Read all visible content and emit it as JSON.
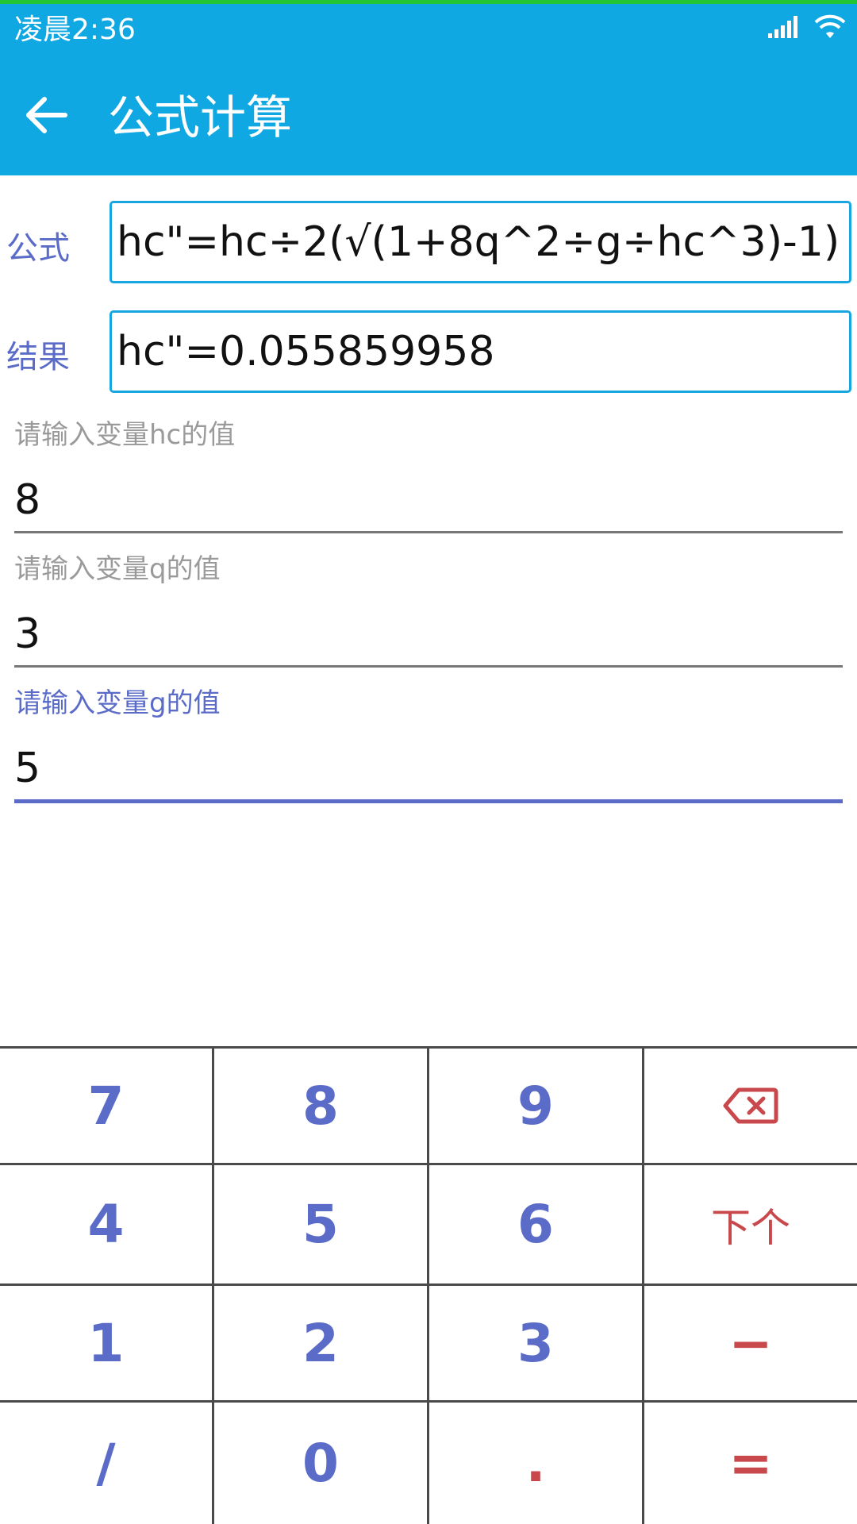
{
  "status_bar": {
    "time": "凌晨2:36",
    "signal_icon": "signal-icon",
    "wifi_icon": "wifi-icon"
  },
  "app_bar": {
    "title": "公式计算",
    "back_icon": "arrow-left-icon",
    "background_color": "#10a8e2"
  },
  "formula": {
    "label": "公式",
    "value": "hc\"=hc÷2(√(1+8q^2÷g÷hc^3)-1)"
  },
  "result": {
    "label": "结果",
    "value": "hc\"=0.055859958"
  },
  "variables": [
    {
      "hint": "请输入变量hc的值",
      "value": "8"
    },
    {
      "hint": "请输入变量q的值",
      "value": "3"
    },
    {
      "hint": "请输入变量g的值",
      "value": "5"
    }
  ],
  "keypad": {
    "rows": [
      [
        "7",
        "8",
        "9",
        "⌫"
      ],
      [
        "4",
        "5",
        "6",
        "下个"
      ],
      [
        "1",
        "2",
        "3",
        "−"
      ],
      [
        "/",
        "0",
        ".",
        "="
      ]
    ],
    "backspace_icon": "backspace-icon",
    "accent_color": "#5b6cc8",
    "action_color": "#c9484c"
  }
}
